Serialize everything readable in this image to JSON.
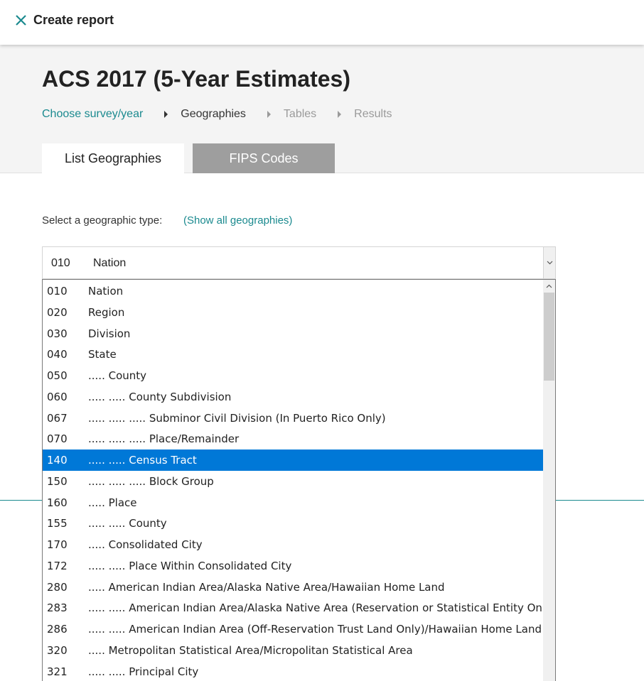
{
  "topbar": {
    "title": "Create report",
    "close_icon": "close-icon"
  },
  "header": {
    "title": "ACS 2017 (5-Year Estimates)",
    "steps": [
      {
        "label": "Choose survey/year",
        "state": "link"
      },
      {
        "label": "Geographies",
        "state": "current"
      },
      {
        "label": "Tables",
        "state": "disabled"
      },
      {
        "label": "Results",
        "state": "disabled"
      }
    ],
    "tabs": [
      {
        "label": "List Geographies",
        "active": true
      },
      {
        "label": "FIPS Codes",
        "active": false
      }
    ]
  },
  "main": {
    "select_label": "Select a geographic type:",
    "show_all_link": "(Show all geographies)",
    "select": {
      "code": "010",
      "name": "Nation"
    },
    "options": [
      {
        "code": "010",
        "name": "Nation"
      },
      {
        "code": "020",
        "name": "Region"
      },
      {
        "code": "030",
        "name": "Division"
      },
      {
        "code": "040",
        "name": "State"
      },
      {
        "code": "050",
        "name": "..... County"
      },
      {
        "code": "060",
        "name": "..... ..... County Subdivision"
      },
      {
        "code": "067",
        "name": "..... ..... ..... Subminor Civil Division (In Puerto Rico Only)"
      },
      {
        "code": "070",
        "name": "..... ..... ..... Place/Remainder"
      },
      {
        "code": "140",
        "name": "..... ..... Census Tract",
        "selected": true
      },
      {
        "code": "150",
        "name": "..... ..... ..... Block Group"
      },
      {
        "code": "160",
        "name": "..... Place"
      },
      {
        "code": "155",
        "name": "..... ..... County"
      },
      {
        "code": "170",
        "name": "..... Consolidated City"
      },
      {
        "code": "172",
        "name": "..... ..... Place Within Consolidated City"
      },
      {
        "code": "280",
        "name": "..... American Indian Area/Alaska Native Area/Hawaiian Home Land"
      },
      {
        "code": "283",
        "name": "..... ..... American Indian Area/Alaska Native Area (Reservation or Statistical Entity Only)"
      },
      {
        "code": "286",
        "name": "..... ..... American Indian Area (Off-Reservation Trust Land Only)/Hawaiian Home Land"
      },
      {
        "code": "320",
        "name": "..... Metropolitan Statistical Area/Micropolitan Statistical Area"
      },
      {
        "code": "321",
        "name": "..... ..... Principal City"
      }
    ]
  },
  "colors": {
    "accent": "#1b8a8f",
    "selected_option": "#0078d7",
    "inactive_tab": "#9e9e9e"
  }
}
